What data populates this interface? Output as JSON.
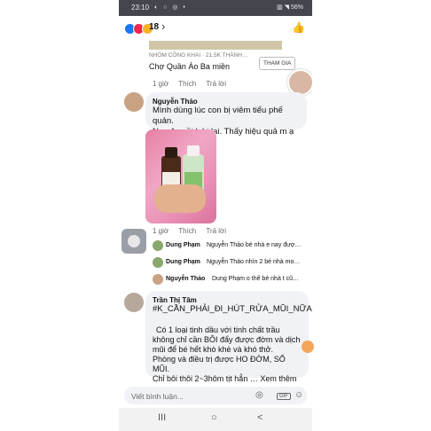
{
  "status_bar": {
    "time": "23:10",
    "left_icons": "◐ ○ ◎ •",
    "right_icons": "▥ ◥ 56%"
  },
  "reactions": {
    "count": "18",
    "icons": [
      "like",
      "love",
      "haha"
    ]
  },
  "shared_post": {
    "group": "NHÓM CÔNG KHAI · 21,5K THÀNH…",
    "title": "Chợ Quần Áo Ba miền",
    "join_label": "THAM GIA"
  },
  "comment_actions": {
    "time": "1 giờ",
    "like": "Thích",
    "reply": "Trả lời"
  },
  "comment1": {
    "author": "Nguyễn Thảo",
    "lines": [
      "Mình dùng lúc con bị viêm tiểu phế quản.",
      "Nay 4m rồi k bị lại. Thấy hiệu quả m ạ"
    ],
    "actions": {
      "time": "1 giờ",
      "like": "Thích",
      "reply": "Trả lời"
    }
  },
  "replies": [
    {
      "author": "Dung Phạm",
      "text": "Nguyễn Thảo bé nhà e nay đượ…"
    },
    {
      "author": "Dung Phạm",
      "text": "Nguyễn Thảo nhìn 2 bé nhà mo…"
    },
    {
      "author": "Nguyễn Thảo",
      "text": "Dung Phạm o thế bé nhà t cũ…"
    }
  ],
  "comment2": {
    "author": "Trần Thị Tâm",
    "hashtag": "#K_CẦN_PHẢI_ĐI_HÚT_RỬA_MŨI_NỮA",
    "lines": [
      "Có 1 loại tinh dầu với tinh chất trầu",
      "không chỉ cần BÔI đẩy được đờm và dịch",
      "mũi để bé hết khò khè và khó thở.",
      "Phòng và điều trị được HO ĐỜM, SỔ MŨI.",
      "Chỉ bôi thôi 2~3hôm tịt hẳn … Xem thêm"
    ]
  },
  "composer": {
    "placeholder": "Viết bình luận...",
    "gif_label": "GIF"
  },
  "navbar": {
    "recents": "III",
    "home": "○",
    "back": "<"
  }
}
